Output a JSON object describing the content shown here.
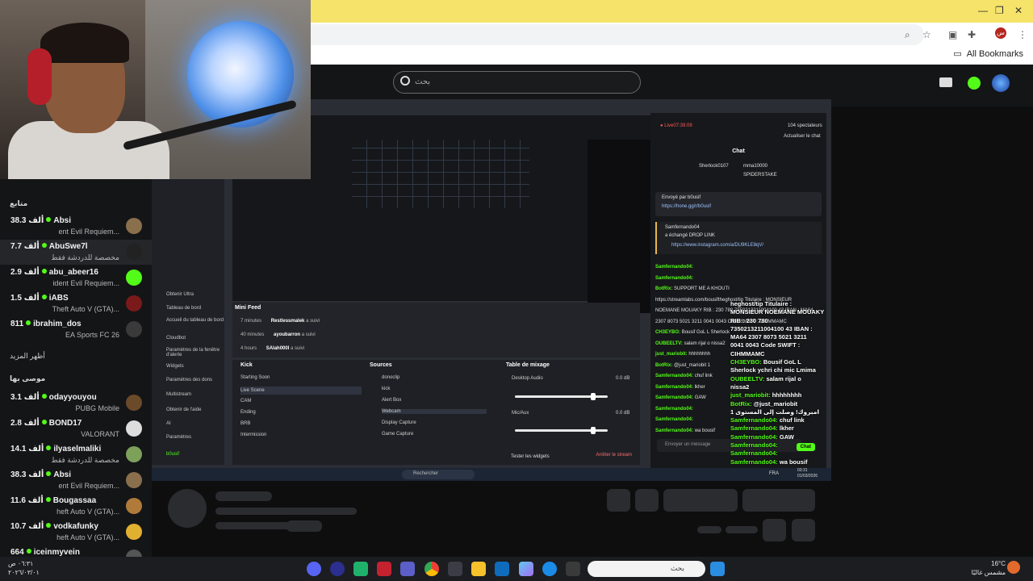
{
  "browser": {
    "bookmarks_label": "All Bookmarks",
    "profile_letter": "س"
  },
  "kick": {
    "search_placeholder": "بحث"
  },
  "sidebar": {
    "following_title": "متابع",
    "show_more": "أظهر المزيد",
    "recommended_title": "موصى بها",
    "following": [
      {
        "count": "38.3 ألف",
        "name": "Absi",
        "game": "...ent Evil Requiem",
        "avatar": "#8a6f4c",
        "selected": false
      },
      {
        "count": "7.7 ألف",
        "name": "AbuSwe7l",
        "game": "مخصصة للدردشة فقط",
        "avatar": "#222",
        "selected": true
      },
      {
        "count": "2.9 ألف",
        "name": "abu_abeer16",
        "game": "...ident Evil Requiem",
        "avatar": "#53fc18",
        "selected": false
      },
      {
        "count": "1.5 ألف",
        "name": "iABS",
        "game": "...Theft Auto V (GTA)",
        "avatar": "#7a1a1a",
        "selected": false
      },
      {
        "count": "811",
        "name": "ibrahim_dos",
        "game": "EA Sports FC 26",
        "avatar": "#3a3a3a",
        "selected": false
      }
    ],
    "recommended": [
      {
        "count": "3.1 ألف",
        "name": "odayyouyou",
        "game": "PUBG Mobile",
        "avatar": "#6b4a2a"
      },
      {
        "count": "2.8 ألف",
        "name": "BOND17",
        "game": "VALORANT",
        "avatar": "#ddd"
      },
      {
        "count": "14.1 ألف",
        "name": "ilyaselmaliki",
        "game": "مخصصة للدردشة فقط",
        "avatar": "#7da05a"
      },
      {
        "count": "38.3 ألف",
        "name": "Absi",
        "game": "...ent Evil Requiem",
        "avatar": "#8a6f4c"
      },
      {
        "count": "11.6 ألف",
        "name": "Bougassaa",
        "game": "...heft Auto V (GTA)",
        "avatar": "#b07a3a"
      },
      {
        "count": "10.7 ألف",
        "name": "vodkafunky",
        "game": "...heft Auto V (GTA)",
        "avatar": "#e0b030"
      },
      {
        "count": "664",
        "name": "iceinmyvein",
        "game": "",
        "avatar": "#555"
      }
    ]
  },
  "obs": {
    "left_menu": [
      "Obtenir Ultra",
      "Tableau de bord",
      "Accueil du tableau de bord",
      "Cloudbot",
      "Paramètres de la fenêtre d'alerte",
      "Widgets",
      "Paramètres des dons",
      "Multistream",
      "Obtenir de l'aide",
      "AI",
      "Paramètres",
      "b0usif"
    ],
    "mini_feed_title": "Mini Feed",
    "feed": [
      {
        "time": "7 minutes",
        "user": "Restlessmalek",
        "action": "a suivi"
      },
      {
        "time": "40 minutes",
        "user": "ayoubarron",
        "action": "a suivi"
      },
      {
        "time": "4 hours",
        "user": "SAlah000I",
        "action": "a suivi"
      }
    ],
    "scenes_title": "Kick",
    "scenes": [
      "Starting Soon",
      "Live Scene",
      "CAM",
      "Ending",
      "BRB",
      "Intermission"
    ],
    "sources_title": "Sources",
    "sources": [
      "donoclip",
      "kick",
      "Alert Box",
      "Webcam",
      "Display Capture",
      "Game Capture"
    ],
    "mixer_title": "Table de mixage",
    "mixer": [
      {
        "name": "Desktop Audio",
        "db": "0.0 dB",
        "level": 0.84
      },
      {
        "name": "Mic/Aux",
        "db": "0.0 dB",
        "level": 0.84
      }
    ],
    "test_widgets": "Tester les widgets",
    "stop_stream": "Arrêter le stream"
  },
  "stream_chat": {
    "live_label": "Live",
    "uptime": "07:39:09",
    "viewers": "104 spectateurs",
    "refresh": "Actualiser le chat",
    "chat_title": "Chat",
    "top_gifters": [
      "Sherlock0107",
      "mma10000",
      "SPIDERSTAKE"
    ],
    "pinned_by": "Envoyé par",
    "pinned_user": "b0usif",
    "pinned_link": "https://hone.gg/r/b0usif",
    "drop_user": "Samfernando04",
    "drop_text": "a échangé DROP LINK",
    "drop_link": "https://www.instagram.com/a/DU9KLE8qV/",
    "lines": [
      {
        "user": "Samfernando04:",
        "text": ""
      },
      {
        "user": "Samfernando04:",
        "text": ""
      },
      {
        "user": "BotRix:",
        "text": "SUPPORT ME A KHOUTI"
      },
      {
        "user": "",
        "text": "https://streamlabs.com/bousiftheghost/tip Titulaire : MONSIEUR"
      },
      {
        "user": "",
        "text": "NOEMANE MOUAKY RIB : 230 780 7350213211004100 43 IBAN : MA64"
      },
      {
        "user": "",
        "text": "2307 8073 5021 3211 0041 0043 Code SWIFT : CIHMMAMC"
      },
      {
        "user": "CH3EYBO:",
        "text": "Bousif GoL L Sherlock"
      },
      {
        "user": "OUBEELTV:",
        "text": "salam rijal o nissa2"
      },
      {
        "user": "just_mariobit:",
        "text": "hhhhhhhh"
      },
      {
        "user": "BotRix:",
        "text": "@just_mariobit 1"
      },
      {
        "user": "Samfernando04:",
        "text": "chuf link"
      },
      {
        "user": "Samfernando04:",
        "text": "lkher"
      },
      {
        "user": "Samfernando04:",
        "text": "GAW"
      },
      {
        "user": "Samfernando04:",
        "text": ""
      },
      {
        "user": "Samfernando04:",
        "text": ""
      },
      {
        "user": "Samfernando04:",
        "text": "wa bousif"
      }
    ],
    "input_placeholder": "Envoyer un message",
    "send_label": "Chat"
  },
  "overlay_chat": [
    {
      "user": "",
      "text": "heghost/tip Titulaire :"
    },
    {
      "user": "",
      "text": "MONSIEUR NOEMANE MOUAKY"
    },
    {
      "user": "",
      "text": "RIB : 230 780"
    },
    {
      "user": "",
      "text": "7350213211004100 43 IBAN :"
    },
    {
      "user": "",
      "text": "MA64 2307 8073 5021 3211"
    },
    {
      "user": "",
      "text": "0041 0043 Code SWIFT :"
    },
    {
      "user": "",
      "text": "CIHMMAMC"
    },
    {
      "user": "CH3EYBO:",
      "text": "Bousif GoL L"
    },
    {
      "user": "",
      "text": "Sherlock ychri chi mic Lmima"
    },
    {
      "user": "OUBEELTV:",
      "text": "salam rijal o"
    },
    {
      "user": "",
      "text": "nissa2"
    },
    {
      "user": "just_mariobit:",
      "text": "hhhhhhhh"
    },
    {
      "user": "BotRix:",
      "text": "@just_mariobit"
    },
    {
      "user": "",
      "text": "امبروك! وصلت إلى المستوى 1"
    },
    {
      "user": "Samfernando04:",
      "text": "chuf link"
    },
    {
      "user": "Samfernando04:",
      "text": "lkher"
    },
    {
      "user": "Samfernando04:",
      "text": "GAW"
    },
    {
      "user": "Samfernando04:",
      "text": ""
    },
    {
      "user": "Samfernando04:",
      "text": ""
    },
    {
      "user": "Samfernando04:",
      "text": "wa bousif"
    }
  ],
  "inner_taskbar": {
    "search": "Rechercher",
    "lang": "FRA",
    "time": "03:31",
    "date": "01/03/2026"
  },
  "taskbar": {
    "time": "٠٦:٣١ ص",
    "date": "٢٠٢٦/٠٣/٠١",
    "search_placeholder": "بحث",
    "temperature": "16°C",
    "weather": "مشمس غالبًا"
  }
}
